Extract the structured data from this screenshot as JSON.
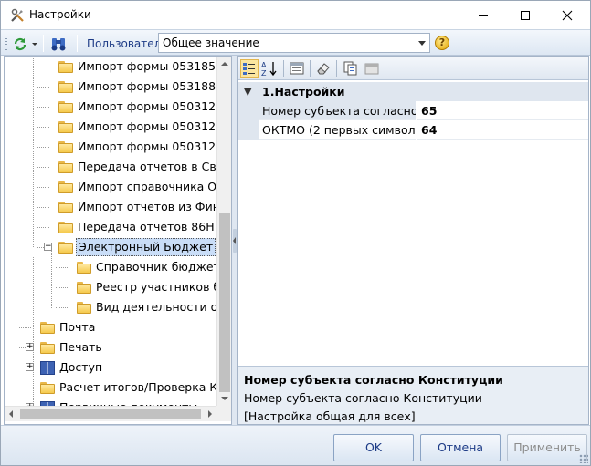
{
  "window": {
    "title": "Настройки",
    "minimize_icon": "minimize-icon",
    "maximize_icon": "maximize-icon",
    "close_icon": "close-icon"
  },
  "toolbar": {
    "refresh_icon": "refresh-icon",
    "binoculars_icon": "binoculars-icon",
    "user_label": "Пользователь",
    "scope_value": "Общее значение",
    "help_icon": "help-icon"
  },
  "tree": {
    "items": [
      {
        "label": "Импорт формы 053185",
        "icon": "folder-icon"
      },
      {
        "label": "Импорт формы 053188",
        "icon": "folder-icon"
      },
      {
        "label": "Импорт формы 050312",
        "icon": "folder-icon"
      },
      {
        "label": "Импорт формы 050312",
        "icon": "folder-icon"
      },
      {
        "label": "Импорт формы 050312",
        "icon": "folder-icon"
      },
      {
        "label": "Передача отчетов в Св",
        "icon": "folder-icon"
      },
      {
        "label": "Импорт справочника О",
        "icon": "folder-icon"
      },
      {
        "label": "Импорт отчетов из Фин",
        "icon": "folder-icon"
      },
      {
        "label": "Передача отчетов 86Н",
        "icon": "folder-icon"
      },
      {
        "label": "Электронный Бюджет",
        "icon": "folder-icon",
        "expander": "−"
      },
      {
        "label": "Справочник бюджет",
        "icon": "folder-icon"
      },
      {
        "label": "Реестр участников б",
        "icon": "folder-icon"
      },
      {
        "label": "Вид деятельности ор",
        "icon": "folder-icon"
      },
      {
        "label": "Почта",
        "icon": "folder-icon"
      },
      {
        "label": "Печать",
        "icon": "folder-icon",
        "expander": "+"
      },
      {
        "label": "Доступ",
        "icon": "book-icon",
        "expander": "+"
      },
      {
        "label": "Расчет итогов/Проверка К",
        "icon": "folder-icon"
      },
      {
        "label": "Первичные документы",
        "icon": "book-icon",
        "expander": "+"
      }
    ]
  },
  "properties": {
    "category": "1.Настройки",
    "rows": [
      {
        "name": "Номер субъекта согласно",
        "value": "65"
      },
      {
        "name": "ОКТМО (2 первых символ",
        "value": "64"
      }
    ],
    "description_title": "Номер субъекта согласно Конституции",
    "description_lines": [
      "Номер субъекта согласно Конституции",
      "[Настройка общая для всех]"
    ]
  },
  "buttons": {
    "ok": "OK",
    "cancel": "Отмена",
    "apply": "Применить"
  }
}
